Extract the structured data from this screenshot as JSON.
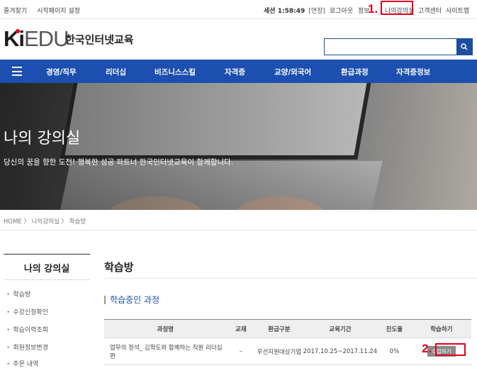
{
  "topbar": {
    "favorites": "즐겨찾기",
    "set_homepage": "시작페이지 설정",
    "session_label": "세션",
    "session_time": "1:58:49",
    "session_extend": "[연장]",
    "logout": "로그아웃",
    "member_info": "정보",
    "my_classroom": "나의강의실",
    "customer_center": "고객센터",
    "sitemap": "사이트맵",
    "marker_1": "1.",
    "marker_2": "2."
  },
  "header": {
    "logo_k": "Ki",
    "logo_rest": "EDU",
    "brand": "한국인터넷교육",
    "search_placeholder": "",
    "search_icon": "search-icon"
  },
  "nav": {
    "menu_icon": "hamburger-icon",
    "items": [
      "경영/직무",
      "리더십",
      "비즈니스스킬",
      "자격증",
      "교양/외국어",
      "환급과정",
      "자격증정보"
    ]
  },
  "hero": {
    "title": "나의 강의실",
    "subtitle": "당신의 꿈을 향한 도전! 행복한 성공 파트너 한국인터넷교육이 함께합니다."
  },
  "breadcrumb": "HOME 〉 나의강의실 〉 학습방",
  "sidebar": {
    "title": "나의 강의실",
    "items": [
      "학습방",
      "수강신청확인",
      "학습이력조회",
      "회원정보변경",
      "주문 내역"
    ]
  },
  "main": {
    "title": "학습방",
    "section_title": "학습중인 과정",
    "table": {
      "headers": [
        "과정명",
        "교재",
        "환급구분",
        "교육기간",
        "진도율",
        "학습하기"
      ],
      "rows": [
        {
          "course": "업무의 정석_ 김학도와 함께하는 직원 리더십편",
          "textbook": "–",
          "refund_type": "우선지원대상기업",
          "period": "2017.10.25~2017.11.24",
          "progress": "0%",
          "action": "수업하기"
        }
      ]
    }
  }
}
